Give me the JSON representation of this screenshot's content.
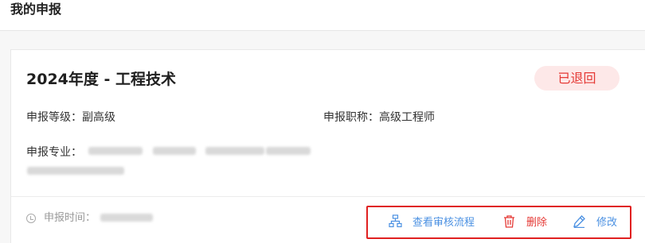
{
  "header": {
    "title": "我的申报"
  },
  "card": {
    "title": "2024年度 - 工程技术",
    "status": "已退回",
    "level_label": "申报等级：副高级",
    "professional_title_label": "申报职称：高级工程师",
    "specialty_label": "申报专业：",
    "time_label": "申报时间："
  },
  "actions": {
    "view_flow": "查看审核流程",
    "delete": "删除",
    "edit": "修改"
  },
  "colors": {
    "primary": "#4a90e2",
    "danger": "#e53935",
    "badge_bg": "#fde8e8",
    "highlight_border": "#e02020"
  }
}
